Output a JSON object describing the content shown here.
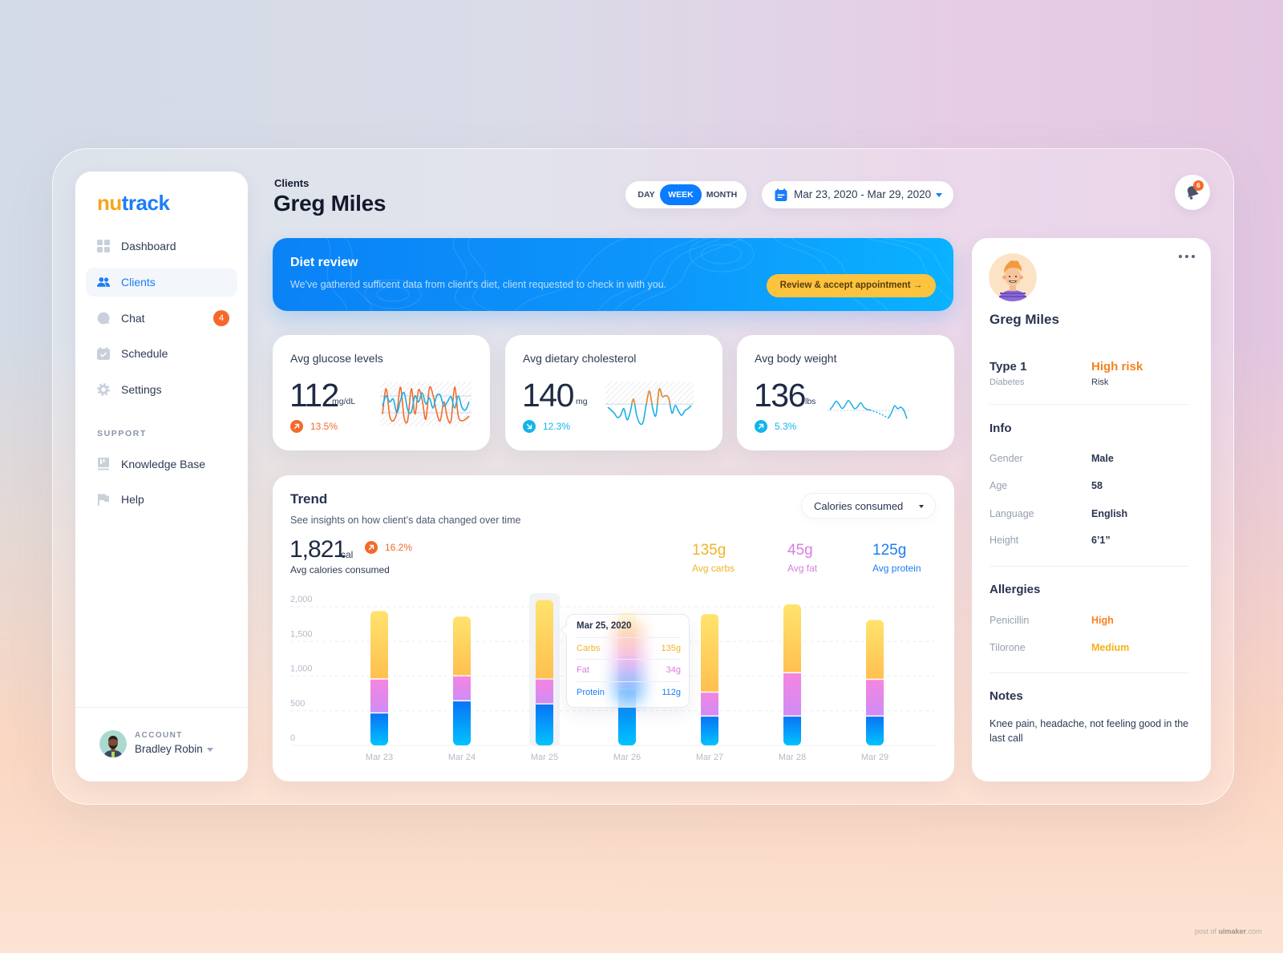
{
  "app": {
    "logo_part1": "nu",
    "logo_part2": "track"
  },
  "sidebar": {
    "items": [
      {
        "label": "Dashboard",
        "icon": "grid-icon"
      },
      {
        "label": "Clients",
        "icon": "users-icon",
        "active": true
      },
      {
        "label": "Chat",
        "icon": "chat-icon",
        "badge": "4"
      },
      {
        "label": "Schedule",
        "icon": "calendar-icon"
      },
      {
        "label": "Settings",
        "icon": "gear-icon"
      }
    ],
    "support_label": "SUPPORT",
    "support_items": [
      {
        "label": "Knowledge Base",
        "icon": "book-icon"
      },
      {
        "label": "Help",
        "icon": "flag-icon"
      }
    ],
    "account": {
      "label": "ACCOUNT",
      "name": "Bradley Robin"
    }
  },
  "header": {
    "breadcrumb": "Clients",
    "title": "Greg Miles",
    "period_options": [
      "DAY",
      "WEEK",
      "MONTH"
    ],
    "period_selected": "WEEK",
    "date_range": "Mar 23, 2020 - Mar 29, 2020",
    "notification_count": "6"
  },
  "banner": {
    "title": "Diet review",
    "text": "We've gathered sufficent data from client's diet, client requested to check in with you.",
    "button_label": "Review & accept appointment →"
  },
  "stats": [
    {
      "title": "Avg glucose levels",
      "value": "112",
      "unit": "mg/dL",
      "change": "13.5%",
      "direction": "up",
      "change_color": "#f4692a",
      "sparkline": {
        "series_a": [
          25,
          88,
          20,
          8,
          30,
          92,
          15,
          10,
          88,
          25,
          85,
          60,
          12,
          90,
          72,
          30,
          8,
          55,
          15,
          8,
          92,
          20,
          8,
          12,
          20
        ],
        "series_b": [
          45,
          70,
          55,
          62,
          28,
          60,
          78,
          35,
          30,
          70,
          55,
          78,
          50,
          65,
          40,
          70,
          72,
          45,
          55,
          68,
          40,
          70,
          42,
          35,
          55
        ],
        "color_a": "#f26b2a",
        "color_b": "#1aaee8"
      }
    },
    {
      "title": "Avg dietary cholesterol",
      "value": "140",
      "unit": "mg",
      "change": "12.3%",
      "direction": "down",
      "change_color": "#13b5ea",
      "sparkline": {
        "values": [
          48,
          42,
          35,
          25,
          30,
          45,
          20,
          38,
          66,
          30,
          12,
          15,
          55,
          84,
          45,
          30,
          88,
          72,
          74,
          68,
          35,
          52,
          40,
          30,
          40,
          45,
          52
        ],
        "threshold": 55,
        "color_above": "#f28a2a",
        "color_below": "#1aaee8"
      }
    },
    {
      "title": "Avg body weight",
      "value": "136",
      "unit": "lbs",
      "change": "5.3%",
      "direction": "up",
      "change_color": "#13b5ea",
      "sparkline": {
        "values": [
          40,
          55,
          72,
          60,
          45,
          58,
          74,
          60,
          44,
          52,
          66,
          50,
          42,
          40,
          36,
          32,
          27,
          22,
          16,
          10,
          30,
          55,
          44,
          50,
          38,
          8
        ],
        "dashed_segment": [
          13,
          19
        ],
        "baseline": 38,
        "color": "#1aaee8"
      }
    }
  ],
  "trend": {
    "title": "Trend",
    "subtitle": "See insights on how client’s data changed over time",
    "metric_select": "Calories consumed",
    "avg_value": "1,821",
    "avg_unit": "cal",
    "avg_change": "16.2%",
    "avg_label": "Avg calories consumed",
    "macros": [
      {
        "value": "135g",
        "label": "Avg carbs",
        "color": "#f0b429"
      },
      {
        "value": "45g",
        "label": "Avg fat",
        "color": "#d97de0"
      },
      {
        "value": "125g",
        "label": "Avg protein",
        "color": "#1a7ef5"
      }
    ],
    "tooltip": {
      "date": "Mar 25, 2020",
      "rows": [
        {
          "label": "Carbs",
          "value": "135g",
          "color": "#f0b429"
        },
        {
          "label": "Fat",
          "value": "34g",
          "color": "#d97de0"
        },
        {
          "label": "Protein",
          "value": "112g",
          "color": "#1a7ef5"
        }
      ]
    }
  },
  "profile": {
    "name": "Greg Miles",
    "condition": "Type 1",
    "condition_label": "Diabetes",
    "risk": "High risk",
    "risk_label": "Risk",
    "info_title": "Info",
    "info": [
      {
        "key": "Gender",
        "value": "Male"
      },
      {
        "key": "Age",
        "value": "58"
      },
      {
        "key": "Language",
        "value": "English"
      },
      {
        "key": "Height",
        "value": "6’1”"
      }
    ],
    "allergies_title": "Allergies",
    "allergies": [
      {
        "name": "Penicillin",
        "level": "High",
        "color": "#f58220"
      },
      {
        "name": "Tilorone",
        "level": "Medium",
        "color": "#f5b216"
      }
    ],
    "notes_title": "Notes",
    "notes": "Knee pain, headache, not feeling good in the last call"
  },
  "chart_data": {
    "type": "bar",
    "stacked": true,
    "title": "Trend",
    "xlabel": "",
    "ylabel": "Calories consumed",
    "categories": [
      "Mar 23",
      "Mar 24",
      "Mar 25",
      "Mar 26",
      "Mar 27",
      "Mar 28",
      "Mar 29"
    ],
    "series": [
      {
        "name": "Protein",
        "values": [
          460,
          635,
          590,
          800,
          415,
          415,
          415
        ],
        "color_top": "#0a74f5",
        "color_bottom": "#00c3ff"
      },
      {
        "name": "Fat",
        "values": [
          490,
          360,
          360,
          500,
          345,
          625,
          530
        ],
        "color_top": "#f585e0",
        "color_bottom": "#cf8cf6"
      },
      {
        "name": "Carbs",
        "values": [
          990,
          865,
          1150,
          600,
          1135,
          995,
          865
        ],
        "color_top": "#ffe36e",
        "color_bottom": "#ffc04f"
      }
    ],
    "ylim": [
      0,
      2000
    ],
    "yticks": [
      0,
      500,
      1000,
      1500,
      2000
    ],
    "ytick_labels": [
      "0",
      "500",
      "1,000",
      "1,500",
      "2,000"
    ],
    "grid": true,
    "legend": "none",
    "highlighted_category": "Mar 25"
  },
  "watermark": {
    "prefix": "post of ",
    "brand": "uimaker",
    "suffix": ".com"
  }
}
